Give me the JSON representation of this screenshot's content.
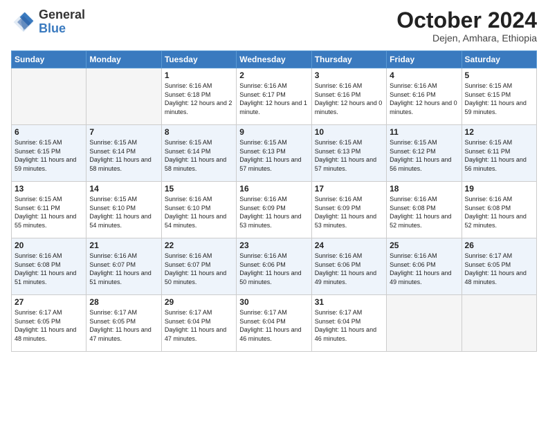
{
  "header": {
    "logo_general": "General",
    "logo_blue": "Blue",
    "month": "October 2024",
    "location": "Dejen, Amhara, Ethiopia"
  },
  "days_of_week": [
    "Sunday",
    "Monday",
    "Tuesday",
    "Wednesday",
    "Thursday",
    "Friday",
    "Saturday"
  ],
  "weeks": [
    [
      {
        "day": "",
        "sunrise": "",
        "sunset": "",
        "daylight": "",
        "empty": true
      },
      {
        "day": "",
        "sunrise": "",
        "sunset": "",
        "daylight": "",
        "empty": true
      },
      {
        "day": "1",
        "sunrise": "Sunrise: 6:16 AM",
        "sunset": "Sunset: 6:18 PM",
        "daylight": "Daylight: 12 hours and 2 minutes."
      },
      {
        "day": "2",
        "sunrise": "Sunrise: 6:16 AM",
        "sunset": "Sunset: 6:17 PM",
        "daylight": "Daylight: 12 hours and 1 minute."
      },
      {
        "day": "3",
        "sunrise": "Sunrise: 6:16 AM",
        "sunset": "Sunset: 6:16 PM",
        "daylight": "Daylight: 12 hours and 0 minutes."
      },
      {
        "day": "4",
        "sunrise": "Sunrise: 6:16 AM",
        "sunset": "Sunset: 6:16 PM",
        "daylight": "Daylight: 12 hours and 0 minutes."
      },
      {
        "day": "5",
        "sunrise": "Sunrise: 6:15 AM",
        "sunset": "Sunset: 6:15 PM",
        "daylight": "Daylight: 11 hours and 59 minutes."
      }
    ],
    [
      {
        "day": "6",
        "sunrise": "Sunrise: 6:15 AM",
        "sunset": "Sunset: 6:15 PM",
        "daylight": "Daylight: 11 hours and 59 minutes."
      },
      {
        "day": "7",
        "sunrise": "Sunrise: 6:15 AM",
        "sunset": "Sunset: 6:14 PM",
        "daylight": "Daylight: 11 hours and 58 minutes."
      },
      {
        "day": "8",
        "sunrise": "Sunrise: 6:15 AM",
        "sunset": "Sunset: 6:14 PM",
        "daylight": "Daylight: 11 hours and 58 minutes."
      },
      {
        "day": "9",
        "sunrise": "Sunrise: 6:15 AM",
        "sunset": "Sunset: 6:13 PM",
        "daylight": "Daylight: 11 hours and 57 minutes."
      },
      {
        "day": "10",
        "sunrise": "Sunrise: 6:15 AM",
        "sunset": "Sunset: 6:13 PM",
        "daylight": "Daylight: 11 hours and 57 minutes."
      },
      {
        "day": "11",
        "sunrise": "Sunrise: 6:15 AM",
        "sunset": "Sunset: 6:12 PM",
        "daylight": "Daylight: 11 hours and 56 minutes."
      },
      {
        "day": "12",
        "sunrise": "Sunrise: 6:15 AM",
        "sunset": "Sunset: 6:11 PM",
        "daylight": "Daylight: 11 hours and 56 minutes."
      }
    ],
    [
      {
        "day": "13",
        "sunrise": "Sunrise: 6:15 AM",
        "sunset": "Sunset: 6:11 PM",
        "daylight": "Daylight: 11 hours and 55 minutes."
      },
      {
        "day": "14",
        "sunrise": "Sunrise: 6:15 AM",
        "sunset": "Sunset: 6:10 PM",
        "daylight": "Daylight: 11 hours and 54 minutes."
      },
      {
        "day": "15",
        "sunrise": "Sunrise: 6:16 AM",
        "sunset": "Sunset: 6:10 PM",
        "daylight": "Daylight: 11 hours and 54 minutes."
      },
      {
        "day": "16",
        "sunrise": "Sunrise: 6:16 AM",
        "sunset": "Sunset: 6:09 PM",
        "daylight": "Daylight: 11 hours and 53 minutes."
      },
      {
        "day": "17",
        "sunrise": "Sunrise: 6:16 AM",
        "sunset": "Sunset: 6:09 PM",
        "daylight": "Daylight: 11 hours and 53 minutes."
      },
      {
        "day": "18",
        "sunrise": "Sunrise: 6:16 AM",
        "sunset": "Sunset: 6:08 PM",
        "daylight": "Daylight: 11 hours and 52 minutes."
      },
      {
        "day": "19",
        "sunrise": "Sunrise: 6:16 AM",
        "sunset": "Sunset: 6:08 PM",
        "daylight": "Daylight: 11 hours and 52 minutes."
      }
    ],
    [
      {
        "day": "20",
        "sunrise": "Sunrise: 6:16 AM",
        "sunset": "Sunset: 6:08 PM",
        "daylight": "Daylight: 11 hours and 51 minutes."
      },
      {
        "day": "21",
        "sunrise": "Sunrise: 6:16 AM",
        "sunset": "Sunset: 6:07 PM",
        "daylight": "Daylight: 11 hours and 51 minutes."
      },
      {
        "day": "22",
        "sunrise": "Sunrise: 6:16 AM",
        "sunset": "Sunset: 6:07 PM",
        "daylight": "Daylight: 11 hours and 50 minutes."
      },
      {
        "day": "23",
        "sunrise": "Sunrise: 6:16 AM",
        "sunset": "Sunset: 6:06 PM",
        "daylight": "Daylight: 11 hours and 50 minutes."
      },
      {
        "day": "24",
        "sunrise": "Sunrise: 6:16 AM",
        "sunset": "Sunset: 6:06 PM",
        "daylight": "Daylight: 11 hours and 49 minutes."
      },
      {
        "day": "25",
        "sunrise": "Sunrise: 6:16 AM",
        "sunset": "Sunset: 6:06 PM",
        "daylight": "Daylight: 11 hours and 49 minutes."
      },
      {
        "day": "26",
        "sunrise": "Sunrise: 6:17 AM",
        "sunset": "Sunset: 6:05 PM",
        "daylight": "Daylight: 11 hours and 48 minutes."
      }
    ],
    [
      {
        "day": "27",
        "sunrise": "Sunrise: 6:17 AM",
        "sunset": "Sunset: 6:05 PM",
        "daylight": "Daylight: 11 hours and 48 minutes."
      },
      {
        "day": "28",
        "sunrise": "Sunrise: 6:17 AM",
        "sunset": "Sunset: 6:05 PM",
        "daylight": "Daylight: 11 hours and 47 minutes."
      },
      {
        "day": "29",
        "sunrise": "Sunrise: 6:17 AM",
        "sunset": "Sunset: 6:04 PM",
        "daylight": "Daylight: 11 hours and 47 minutes."
      },
      {
        "day": "30",
        "sunrise": "Sunrise: 6:17 AM",
        "sunset": "Sunset: 6:04 PM",
        "daylight": "Daylight: 11 hours and 46 minutes."
      },
      {
        "day": "31",
        "sunrise": "Sunrise: 6:17 AM",
        "sunset": "Sunset: 6:04 PM",
        "daylight": "Daylight: 11 hours and 46 minutes."
      },
      {
        "day": "",
        "sunrise": "",
        "sunset": "",
        "daylight": "",
        "empty": true
      },
      {
        "day": "",
        "sunrise": "",
        "sunset": "",
        "daylight": "",
        "empty": true
      }
    ]
  ]
}
